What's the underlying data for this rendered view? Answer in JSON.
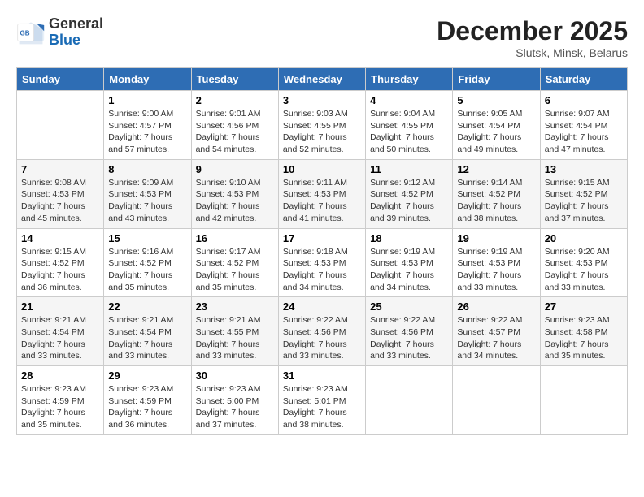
{
  "logo": {
    "general": "General",
    "blue": "Blue"
  },
  "title": "December 2025",
  "subtitle": "Slutsk, Minsk, Belarus",
  "days_of_week": [
    "Sunday",
    "Monday",
    "Tuesday",
    "Wednesday",
    "Thursday",
    "Friday",
    "Saturday"
  ],
  "weeks": [
    [
      {
        "day": "",
        "sunrise": "",
        "sunset": "",
        "daylight": ""
      },
      {
        "day": "1",
        "sunrise": "Sunrise: 9:00 AM",
        "sunset": "Sunset: 4:57 PM",
        "daylight": "Daylight: 7 hours and 57 minutes."
      },
      {
        "day": "2",
        "sunrise": "Sunrise: 9:01 AM",
        "sunset": "Sunset: 4:56 PM",
        "daylight": "Daylight: 7 hours and 54 minutes."
      },
      {
        "day": "3",
        "sunrise": "Sunrise: 9:03 AM",
        "sunset": "Sunset: 4:55 PM",
        "daylight": "Daylight: 7 hours and 52 minutes."
      },
      {
        "day": "4",
        "sunrise": "Sunrise: 9:04 AM",
        "sunset": "Sunset: 4:55 PM",
        "daylight": "Daylight: 7 hours and 50 minutes."
      },
      {
        "day": "5",
        "sunrise": "Sunrise: 9:05 AM",
        "sunset": "Sunset: 4:54 PM",
        "daylight": "Daylight: 7 hours and 49 minutes."
      },
      {
        "day": "6",
        "sunrise": "Sunrise: 9:07 AM",
        "sunset": "Sunset: 4:54 PM",
        "daylight": "Daylight: 7 hours and 47 minutes."
      }
    ],
    [
      {
        "day": "7",
        "sunrise": "Sunrise: 9:08 AM",
        "sunset": "Sunset: 4:53 PM",
        "daylight": "Daylight: 7 hours and 45 minutes."
      },
      {
        "day": "8",
        "sunrise": "Sunrise: 9:09 AM",
        "sunset": "Sunset: 4:53 PM",
        "daylight": "Daylight: 7 hours and 43 minutes."
      },
      {
        "day": "9",
        "sunrise": "Sunrise: 9:10 AM",
        "sunset": "Sunset: 4:53 PM",
        "daylight": "Daylight: 7 hours and 42 minutes."
      },
      {
        "day": "10",
        "sunrise": "Sunrise: 9:11 AM",
        "sunset": "Sunset: 4:53 PM",
        "daylight": "Daylight: 7 hours and 41 minutes."
      },
      {
        "day": "11",
        "sunrise": "Sunrise: 9:12 AM",
        "sunset": "Sunset: 4:52 PM",
        "daylight": "Daylight: 7 hours and 39 minutes."
      },
      {
        "day": "12",
        "sunrise": "Sunrise: 9:14 AM",
        "sunset": "Sunset: 4:52 PM",
        "daylight": "Daylight: 7 hours and 38 minutes."
      },
      {
        "day": "13",
        "sunrise": "Sunrise: 9:15 AM",
        "sunset": "Sunset: 4:52 PM",
        "daylight": "Daylight: 7 hours and 37 minutes."
      }
    ],
    [
      {
        "day": "14",
        "sunrise": "Sunrise: 9:15 AM",
        "sunset": "Sunset: 4:52 PM",
        "daylight": "Daylight: 7 hours and 36 minutes."
      },
      {
        "day": "15",
        "sunrise": "Sunrise: 9:16 AM",
        "sunset": "Sunset: 4:52 PM",
        "daylight": "Daylight: 7 hours and 35 minutes."
      },
      {
        "day": "16",
        "sunrise": "Sunrise: 9:17 AM",
        "sunset": "Sunset: 4:52 PM",
        "daylight": "Daylight: 7 hours and 35 minutes."
      },
      {
        "day": "17",
        "sunrise": "Sunrise: 9:18 AM",
        "sunset": "Sunset: 4:53 PM",
        "daylight": "Daylight: 7 hours and 34 minutes."
      },
      {
        "day": "18",
        "sunrise": "Sunrise: 9:19 AM",
        "sunset": "Sunset: 4:53 PM",
        "daylight": "Daylight: 7 hours and 34 minutes."
      },
      {
        "day": "19",
        "sunrise": "Sunrise: 9:19 AM",
        "sunset": "Sunset: 4:53 PM",
        "daylight": "Daylight: 7 hours and 33 minutes."
      },
      {
        "day": "20",
        "sunrise": "Sunrise: 9:20 AM",
        "sunset": "Sunset: 4:53 PM",
        "daylight": "Daylight: 7 hours and 33 minutes."
      }
    ],
    [
      {
        "day": "21",
        "sunrise": "Sunrise: 9:21 AM",
        "sunset": "Sunset: 4:54 PM",
        "daylight": "Daylight: 7 hours and 33 minutes."
      },
      {
        "day": "22",
        "sunrise": "Sunrise: 9:21 AM",
        "sunset": "Sunset: 4:54 PM",
        "daylight": "Daylight: 7 hours and 33 minutes."
      },
      {
        "day": "23",
        "sunrise": "Sunrise: 9:21 AM",
        "sunset": "Sunset: 4:55 PM",
        "daylight": "Daylight: 7 hours and 33 minutes."
      },
      {
        "day": "24",
        "sunrise": "Sunrise: 9:22 AM",
        "sunset": "Sunset: 4:56 PM",
        "daylight": "Daylight: 7 hours and 33 minutes."
      },
      {
        "day": "25",
        "sunrise": "Sunrise: 9:22 AM",
        "sunset": "Sunset: 4:56 PM",
        "daylight": "Daylight: 7 hours and 33 minutes."
      },
      {
        "day": "26",
        "sunrise": "Sunrise: 9:22 AM",
        "sunset": "Sunset: 4:57 PM",
        "daylight": "Daylight: 7 hours and 34 minutes."
      },
      {
        "day": "27",
        "sunrise": "Sunrise: 9:23 AM",
        "sunset": "Sunset: 4:58 PM",
        "daylight": "Daylight: 7 hours and 35 minutes."
      }
    ],
    [
      {
        "day": "28",
        "sunrise": "Sunrise: 9:23 AM",
        "sunset": "Sunset: 4:59 PM",
        "daylight": "Daylight: 7 hours and 35 minutes."
      },
      {
        "day": "29",
        "sunrise": "Sunrise: 9:23 AM",
        "sunset": "Sunset: 4:59 PM",
        "daylight": "Daylight: 7 hours and 36 minutes."
      },
      {
        "day": "30",
        "sunrise": "Sunrise: 9:23 AM",
        "sunset": "Sunset: 5:00 PM",
        "daylight": "Daylight: 7 hours and 37 minutes."
      },
      {
        "day": "31",
        "sunrise": "Sunrise: 9:23 AM",
        "sunset": "Sunset: 5:01 PM",
        "daylight": "Daylight: 7 hours and 38 minutes."
      },
      {
        "day": "",
        "sunrise": "",
        "sunset": "",
        "daylight": ""
      },
      {
        "day": "",
        "sunrise": "",
        "sunset": "",
        "daylight": ""
      },
      {
        "day": "",
        "sunrise": "",
        "sunset": "",
        "daylight": ""
      }
    ]
  ]
}
